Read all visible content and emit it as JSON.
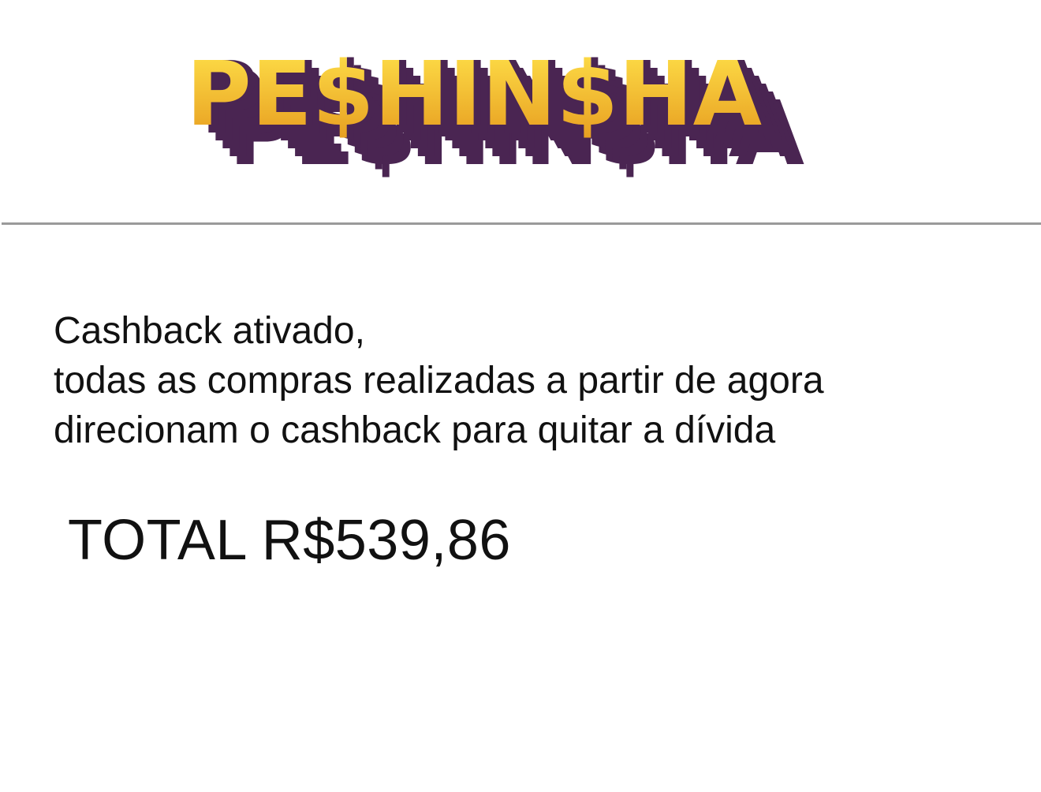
{
  "logo": {
    "text": "PE$HIN$HA",
    "colors": {
      "fill_top": "#ffe24a",
      "fill_bottom": "#e69a1e",
      "shadow": "#4a2552"
    }
  },
  "message": {
    "line1": "Cashback ativado,",
    "line2": "todas as compras realizadas a partir de agora",
    "line3": "direcionam o cashback para quitar a dívida"
  },
  "total": {
    "label": "TOTAL R$539,86"
  },
  "colors": {
    "background": "#ffffff",
    "divider": "#9a9a9a",
    "text": "#111111"
  }
}
